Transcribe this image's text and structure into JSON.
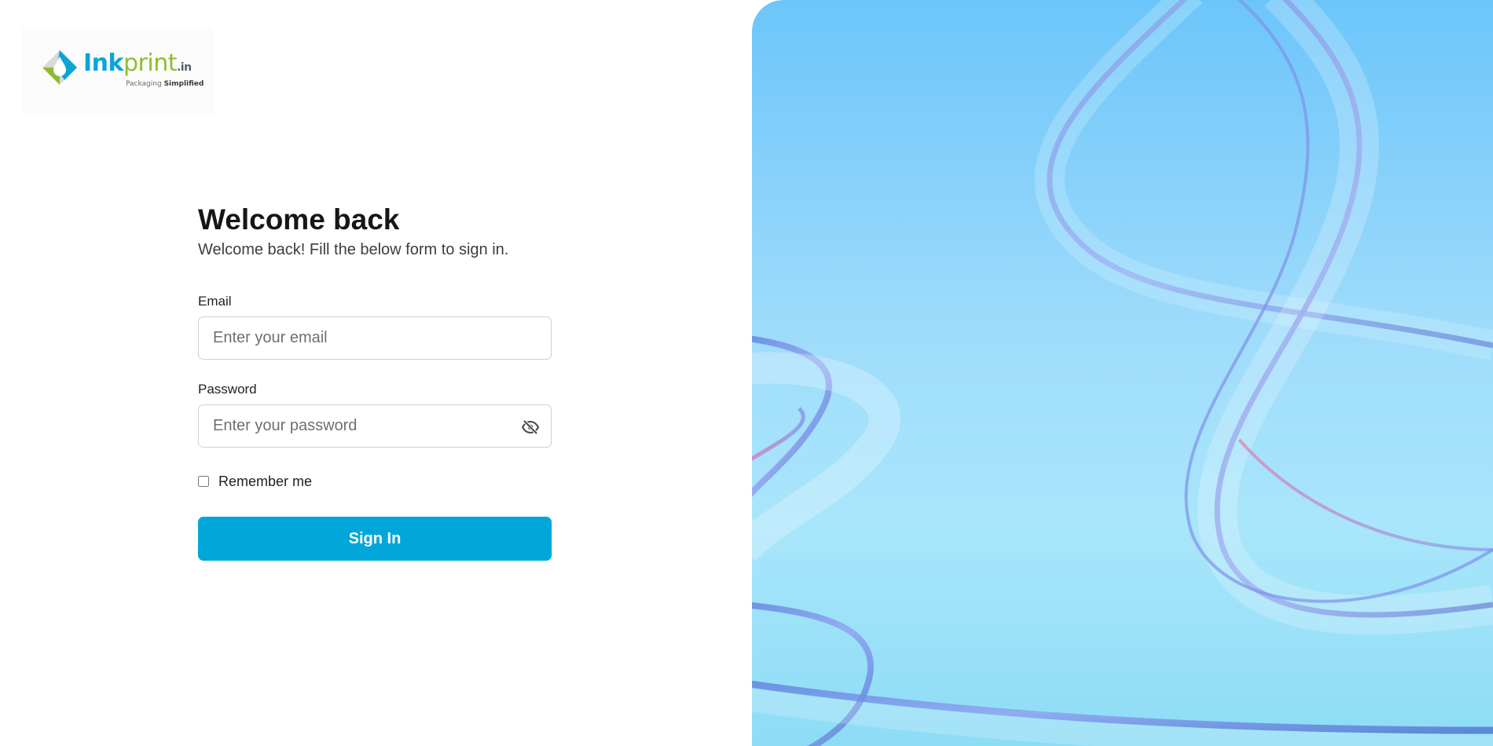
{
  "brand": {
    "logo_text_primary": "Ink",
    "logo_text_secondary": "print",
    "logo_suffix": ".in",
    "tagline_prefix": "Packaging",
    "tagline_emphasis": "Simplified",
    "logo_icon": "diamond-drop-logo-icon",
    "colors": {
      "blue": "#0ba5d6",
      "green": "#8dbd2f"
    }
  },
  "form": {
    "title": "Welcome back",
    "subtitle": "Welcome back! Fill the below form to sign in.",
    "email": {
      "label": "Email",
      "placeholder": "Enter your email",
      "value": ""
    },
    "password": {
      "label": "Password",
      "placeholder": "Enter your password",
      "value": "",
      "toggle_icon": "eye-slash-icon"
    },
    "remember": {
      "label": "Remember me",
      "checked": false
    },
    "submit_label": "Sign In",
    "accent_color": "#00a7d8"
  },
  "hero": {
    "image": "abstract-glass-ribbon-illustration",
    "background_color": "#9fdcfb"
  }
}
